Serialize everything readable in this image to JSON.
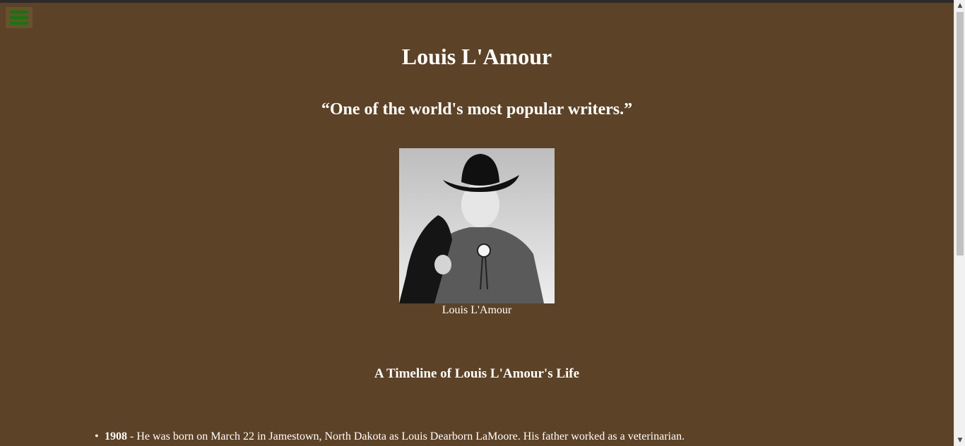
{
  "menu": {
    "icon": "hamburger-icon",
    "accent": "#0d7a0d"
  },
  "header": {
    "title": "Louis L'Amour",
    "quote": "“One of the world's most popular writers.”"
  },
  "figure": {
    "image": "Louis L'Amour portrait photo",
    "caption": "Louis L'Amour"
  },
  "timeline": {
    "heading": "A Timeline of Louis L'Amour's Life",
    "items": [
      {
        "year": "1908",
        "text": " - He was born on March 22 in Jamestown, North Dakota as Louis Dearborn LaMoore. His father worked as a veterinarian."
      }
    ]
  },
  "colors": {
    "background": "#5c4226",
    "text": "#ffffff"
  }
}
